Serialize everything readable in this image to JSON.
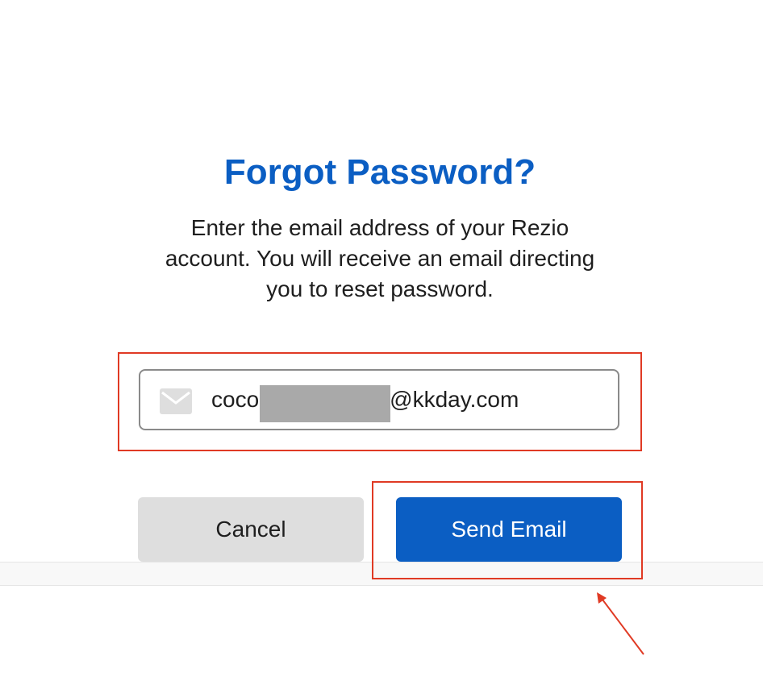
{
  "header": {
    "title": "Forgot Password?",
    "description": "Enter the email address of your Rezio account. You will receive an email directing you to reset password."
  },
  "form": {
    "email_icon": "envelope-icon",
    "email_value": "coco@kkday.com",
    "email_visible_prefix": "coco",
    "email_visible_suffix": "@kkday.com"
  },
  "actions": {
    "cancel_label": "Cancel",
    "send_label": "Send Email"
  },
  "colors": {
    "brand_blue": "#0b5ec3",
    "annotation_red": "#e03a24",
    "cancel_gray": "#dedede",
    "redaction_gray": "#a9a9a9"
  }
}
